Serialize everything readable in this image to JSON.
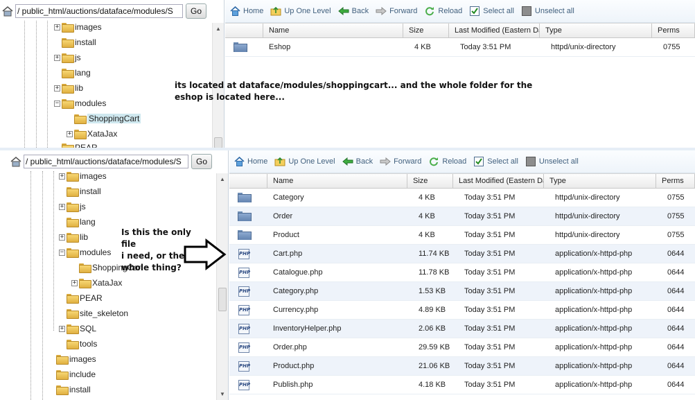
{
  "top_panel": {
    "path_value": "/ public_html/auctions/dataface/modules/S",
    "go_label": "Go",
    "toolbar": [
      {
        "label": "Home",
        "icon": "home-icon"
      },
      {
        "label": "Up One Level",
        "icon": "up-level-icon"
      },
      {
        "label": "Back",
        "icon": "back-arrow-icon"
      },
      {
        "label": "Forward",
        "icon": "forward-arrow-icon"
      },
      {
        "label": "Reload",
        "icon": "reload-icon"
      },
      {
        "label": "Select all",
        "icon": "checkbox-checked-icon"
      },
      {
        "label": "Unselect all",
        "icon": "checkbox-unchecked-icon"
      }
    ],
    "tree": [
      "images",
      "install",
      "js",
      "lang",
      "lib",
      "modules",
      "ShoppingCart",
      "XataJax",
      "PEAR"
    ],
    "columns": [
      "Name",
      "Size",
      "Last Modified (Eastern Da",
      "Type",
      "Perms"
    ],
    "rows": [
      {
        "name": "Eshop",
        "size": "4 KB",
        "modified": "Today 3:51 PM",
        "type": "httpd/unix-directory",
        "perms": "0755"
      }
    ],
    "note": "its located at dataface/modules/shoppingcart... and the whole folder for the eshop is located here..."
  },
  "bottom_panel": {
    "path_value": "/ public_html/auctions/dataface/modules/S",
    "go_label": "Go",
    "toolbar": [
      {
        "label": "Home",
        "icon": "home-icon"
      },
      {
        "label": "Up One Level",
        "icon": "up-level-icon"
      },
      {
        "label": "Back",
        "icon": "back-arrow-icon"
      },
      {
        "label": "Forward",
        "icon": "forward-arrow-icon"
      },
      {
        "label": "Reload",
        "icon": "reload-icon"
      },
      {
        "label": "Select all",
        "icon": "checkbox-checked-icon"
      },
      {
        "label": "Unselect all",
        "icon": "checkbox-unchecked-icon"
      }
    ],
    "tree": [
      "images",
      "install",
      "js",
      "lang",
      "lib",
      "modules",
      "ShoppingCart",
      "XataJax",
      "PEAR",
      "site_skeleton",
      "SQL",
      "tools",
      "images",
      "include",
      "install"
    ],
    "columns": [
      "Name",
      "Size",
      "Last Modified (Eastern Da",
      "Type",
      "Perms"
    ],
    "rows": [
      {
        "name": "Category",
        "size": "4 KB",
        "modified": "Today 3:51 PM",
        "type": "httpd/unix-directory",
        "perms": "0755",
        "kind": "folder"
      },
      {
        "name": "Order",
        "size": "4 KB",
        "modified": "Today 3:51 PM",
        "type": "httpd/unix-directory",
        "perms": "0755",
        "kind": "folder"
      },
      {
        "name": "Product",
        "size": "4 KB",
        "modified": "Today 3:51 PM",
        "type": "httpd/unix-directory",
        "perms": "0755",
        "kind": "folder"
      },
      {
        "name": "Cart.php",
        "size": "11.74 KB",
        "modified": "Today 3:51 PM",
        "type": "application/x-httpd-php",
        "perms": "0644",
        "kind": "php"
      },
      {
        "name": "Catalogue.php",
        "size": "11.78 KB",
        "modified": "Today 3:51 PM",
        "type": "application/x-httpd-php",
        "perms": "0644",
        "kind": "php"
      },
      {
        "name": "Category.php",
        "size": "1.53 KB",
        "modified": "Today 3:51 PM",
        "type": "application/x-httpd-php",
        "perms": "0644",
        "kind": "php"
      },
      {
        "name": "Currency.php",
        "size": "4.89 KB",
        "modified": "Today 3:51 PM",
        "type": "application/x-httpd-php",
        "perms": "0644",
        "kind": "php"
      },
      {
        "name": "InventoryHelper.php",
        "size": "2.06 KB",
        "modified": "Today 3:51 PM",
        "type": "application/x-httpd-php",
        "perms": "0644",
        "kind": "php"
      },
      {
        "name": "Order.php",
        "size": "29.59 KB",
        "modified": "Today 3:51 PM",
        "type": "application/x-httpd-php",
        "perms": "0644",
        "kind": "php"
      },
      {
        "name": "Product.php",
        "size": "21.06 KB",
        "modified": "Today 3:51 PM",
        "type": "application/x-httpd-php",
        "perms": "0644",
        "kind": "php"
      },
      {
        "name": "Publish.php",
        "size": "4.18 KB",
        "modified": "Today 3:51 PM",
        "type": "application/x-httpd-php",
        "perms": "0644",
        "kind": "php"
      }
    ],
    "note_lines": [
      "Is this the only file",
      "i need, or the",
      "whole thing?"
    ]
  }
}
